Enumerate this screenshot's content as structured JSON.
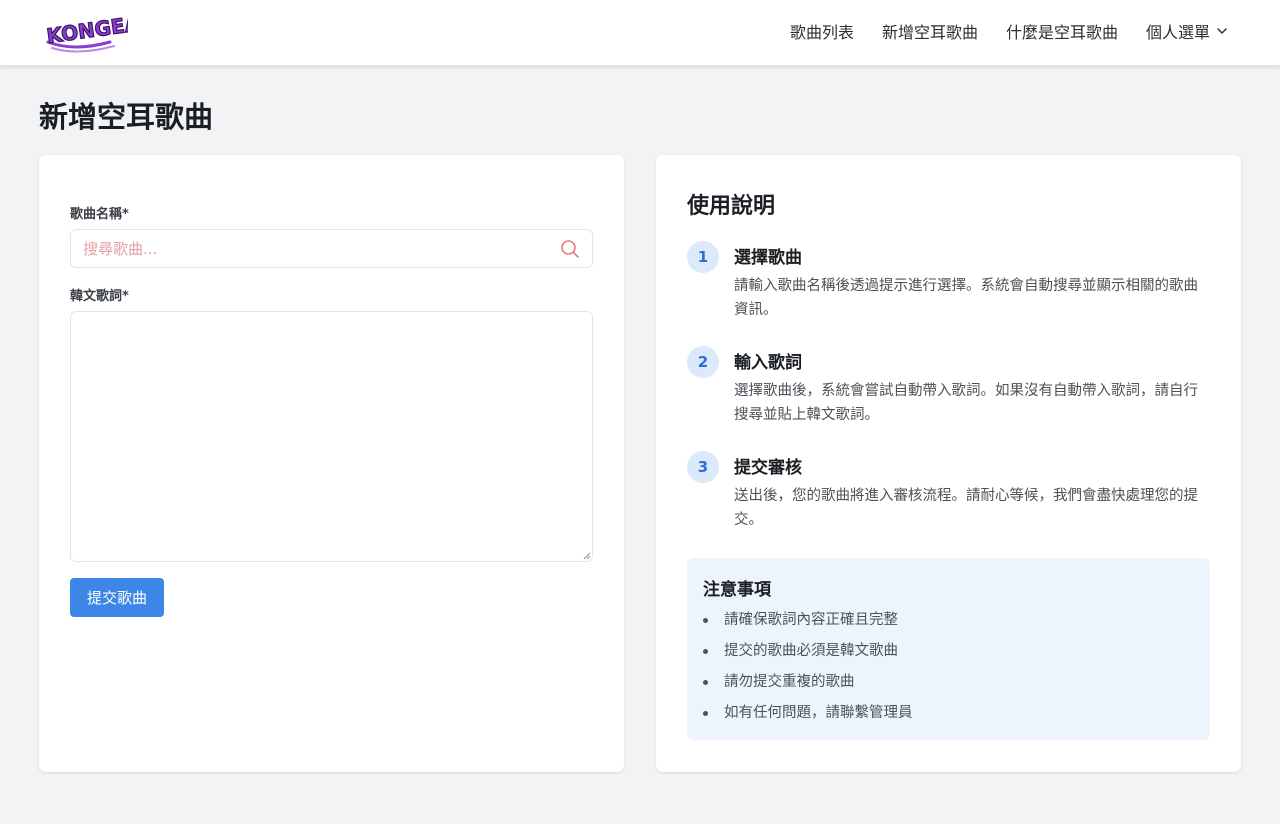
{
  "brand": {
    "logo_text": "KONGEAR",
    "colors": {
      "logo_fill": "#8a3fd1",
      "logo_accent": "#f2c230",
      "primary": "#3c86e8"
    }
  },
  "nav": {
    "items": [
      {
        "label": "歌曲列表"
      },
      {
        "label": "新增空耳歌曲"
      },
      {
        "label": "什麼是空耳歌曲"
      },
      {
        "label": "個人選單",
        "icon": "chevron-down-icon"
      }
    ]
  },
  "page": {
    "title": "新增空耳歌曲"
  },
  "form": {
    "song_name_label": "歌曲名稱*",
    "song_name_placeholder": "搜尋歌曲...",
    "song_name_value": "",
    "lyrics_label": "韓文歌詞*",
    "lyrics_value": "",
    "submit_label": "提交歌曲"
  },
  "instructions": {
    "title": "使用說明",
    "steps": [
      {
        "number": "1",
        "title": "選擇歌曲",
        "desc": "請輸入歌曲名稱後透過提示進行選擇。系統會自動搜尋並顯示相關的歌曲資訊。"
      },
      {
        "number": "2",
        "title": "輸入歌詞",
        "desc": "選擇歌曲後，系統會嘗試自動帶入歌詞。如果沒有自動帶入歌詞，請自行搜尋並貼上韓文歌詞。"
      },
      {
        "number": "3",
        "title": "提交審核",
        "desc": "送出後，您的歌曲將進入審核流程。請耐心等候，我們會盡快處理您的提交。"
      }
    ],
    "notice": {
      "title": "注意事項",
      "items": [
        "請確保歌詞內容正確且完整",
        "提交的歌曲必須是韓文歌曲",
        "請勿提交重複的歌曲",
        "如有任何問題，請聯繫管理員"
      ]
    }
  }
}
